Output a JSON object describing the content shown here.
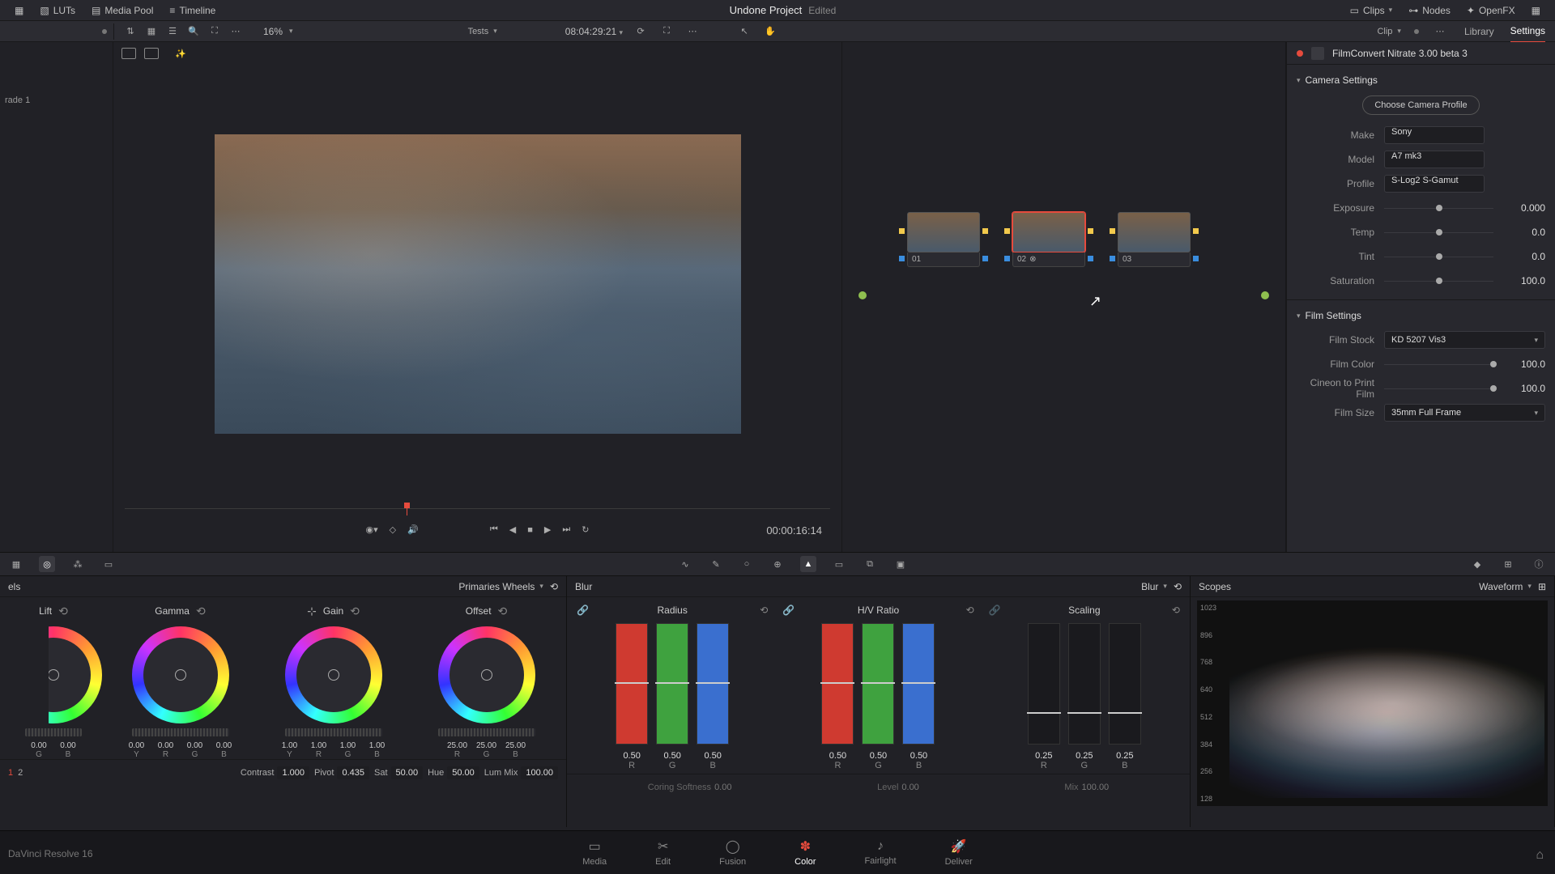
{
  "top": {
    "luts": "LUTs",
    "media_pool": "Media Pool",
    "timeline": "Timeline",
    "title": "Undone Project",
    "edited": "Edited",
    "clips": "Clips",
    "nodes": "Nodes",
    "openfx": "OpenFX"
  },
  "sub": {
    "zoom": "16%",
    "bin": "Tests",
    "timecode": "08:04:29:21",
    "clip_dd": "Clip",
    "tab_library": "Library",
    "tab_settings": "Settings"
  },
  "gallery": {
    "grade_label": "rade 1"
  },
  "viewer": {
    "clip_tc": "00:00:16:14"
  },
  "nodes": {
    "n1": "01",
    "n2": "02",
    "n3": "03"
  },
  "inspector": {
    "plugin": "FilmConvert Nitrate 3.00 beta 3",
    "camera_section": "Camera Settings",
    "choose_profile": "Choose Camera Profile",
    "make_l": "Make",
    "make_v": "Sony",
    "model_l": "Model",
    "model_v": "A7 mk3",
    "profile_l": "Profile",
    "profile_v": "S-Log2 S-Gamut",
    "exposure_l": "Exposure",
    "exposure_v": "0.000",
    "temp_l": "Temp",
    "temp_v": "0.0",
    "tint_l": "Tint",
    "tint_v": "0.0",
    "sat_l": "Saturation",
    "sat_v": "100.0",
    "film_section": "Film Settings",
    "stock_l": "Film Stock",
    "stock_v": "KD 5207 Vis3",
    "fcolor_l": "Film Color",
    "fcolor_v": "100.0",
    "cineon_l": "Cineon to Print Film",
    "cineon_v": "100.0",
    "fsize_l": "Film Size",
    "fsize_v": "35mm Full Frame"
  },
  "wheels": {
    "header": "Primaries Wheels",
    "lift": {
      "label": "Lift",
      "vals": [
        "",
        "",
        "0.00",
        "0.00"
      ],
      "labs": [
        "",
        "",
        "G",
        "B"
      ]
    },
    "gamma": {
      "label": "Gamma",
      "vals": [
        "0.00",
        "0.00",
        "0.00",
        "0.00"
      ],
      "labs": [
        "Y",
        "R",
        "G",
        "B"
      ]
    },
    "gain": {
      "label": "Gain",
      "vals": [
        "1.00",
        "1.00",
        "1.00",
        "1.00"
      ],
      "labs": [
        "Y",
        "R",
        "G",
        "B"
      ]
    },
    "offset": {
      "label": "Offset",
      "vals": [
        "25.00",
        "25.00",
        "25.00"
      ],
      "labs": [
        "R",
        "G",
        "B"
      ]
    },
    "global": {
      "page1": "1",
      "page2": "2",
      "contrast_l": "Contrast",
      "contrast_v": "1.000",
      "pivot_l": "Pivot",
      "pivot_v": "0.435",
      "sat_l": "Sat",
      "sat_v": "50.00",
      "hue_l": "Hue",
      "hue_v": "50.00",
      "lum_l": "Lum Mix",
      "lum_v": "100.00"
    }
  },
  "blur": {
    "header": "Blur",
    "type": "Blur",
    "radius": {
      "label": "Radius",
      "vals": [
        "0.50",
        "0.50",
        "0.50"
      ],
      "labs": [
        "R",
        "G",
        "B"
      ]
    },
    "hv": {
      "label": "H/V Ratio",
      "vals": [
        "0.50",
        "0.50",
        "0.50"
      ],
      "labs": [
        "R",
        "G",
        "B"
      ]
    },
    "scaling": {
      "label": "Scaling",
      "vals": [
        "0.25",
        "0.25",
        "0.25"
      ],
      "labs": [
        "R",
        "G",
        "B"
      ]
    },
    "footer": {
      "coring_l": "Coring Softness",
      "coring_v": "0.00",
      "level_l": "Level",
      "level_v": "0.00",
      "mix_l": "Mix",
      "mix_v": "100.00"
    }
  },
  "scopes": {
    "header": "Scopes",
    "type": "Waveform",
    "scale": [
      "1023",
      "896",
      "768",
      "640",
      "512",
      "384",
      "256",
      "128"
    ]
  },
  "pages": {
    "media": "Media",
    "edit": "Edit",
    "fusion": "Fusion",
    "color": "Color",
    "fairlight": "Fairlight",
    "deliver": "Deliver"
  },
  "app": "DaVinci Resolve 16"
}
